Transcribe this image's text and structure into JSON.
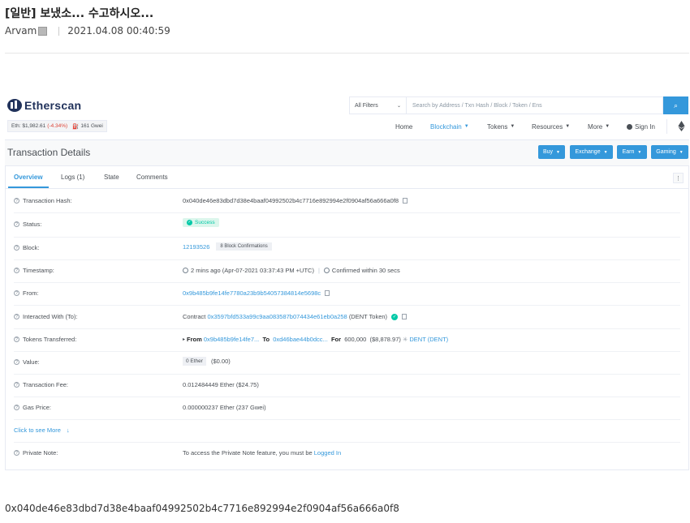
{
  "post": {
    "title": "[일반] 보냈소... 수고하시오...",
    "author": "Arvam",
    "date": "2021.04.08 00:40:59",
    "hash_text": "0x040de46e83dbd7d38e4baaf04992502b4c7716e892994e2f0904af56a666a0f8"
  },
  "etherscan": {
    "logo_text": "Etherscan",
    "eth_price": "Eth: $1,982.61",
    "eth_change": "(-4.34%)",
    "gas": "161 Gwei",
    "search": {
      "filter": "All Filters",
      "placeholder": "Search by Address / Txn Hash / Block / Token / Ens"
    },
    "nav": [
      "Home",
      "Blockchain",
      "Tokens",
      "Resources",
      "More",
      "Sign In"
    ],
    "page_title": "Transaction Details",
    "header_buttons": [
      "Buy",
      "Exchange",
      "Earn",
      "Gaming"
    ],
    "tabs": [
      "Overview",
      "Logs (1)",
      "State",
      "Comments"
    ],
    "accent_color": "#3498db",
    "success_color": "#00c9a7",
    "rows": {
      "tx_hash": {
        "label": "Transaction Hash:",
        "value": "0x040de46e83dbd7d38e4baaf04992502b4c7716e892994e2f0904af56a666a0f8"
      },
      "status": {
        "label": "Status:",
        "value": "Success"
      },
      "block": {
        "label": "Block:",
        "value": "12193526",
        "confirmations": "8 Block Confirmations"
      },
      "timestamp": {
        "label": "Timestamp:",
        "value": "2 mins ago (Apr-07-2021 03:37:43 PM +UTC)",
        "confirmed": "Confirmed within 30 secs"
      },
      "from": {
        "label": "From:",
        "value": "0x9b485b9fe14fe7780a23b9b54057384814e5698c"
      },
      "interacted": {
        "label": "Interacted With (To):",
        "prefix": "Contract",
        "value": "0x3597bfd533a99c9aa083587b074434e61eb0a258",
        "name": "(DENT Token)"
      },
      "tokens": {
        "label": "Tokens Transferred:",
        "from_label": "From",
        "from": "0x9b485b9fe14fe7...",
        "to_label": "To",
        "to": "0xd46bae44b0dcc...",
        "for_label": "For",
        "amount": "600,000",
        "usd": "($8,878.97)",
        "token": "DENT (DENT)"
      },
      "value": {
        "label": "Value:",
        "value": "0 Ether",
        "usd": "($0.00)"
      },
      "fee": {
        "label": "Transaction Fee:",
        "value": "0.012484449 Ether ($24.75)"
      },
      "gas_price": {
        "label": "Gas Price:",
        "value": "0.000000237 Ether (237 Gwei)"
      },
      "click_more": "Click to see More",
      "private_note": {
        "label": "Private Note:",
        "text": "To access the Private Note feature, you must be",
        "link": "Logged In"
      }
    }
  }
}
